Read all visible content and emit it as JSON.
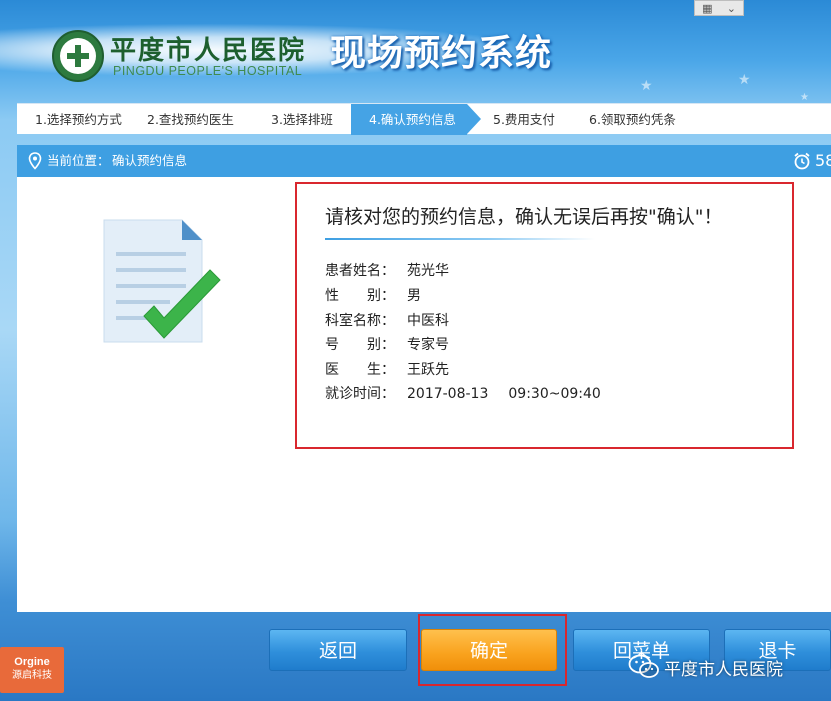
{
  "header": {
    "hospital_name": "平度市人民医院",
    "hospital_name_en": "PINGDU PEOPLE'S HOSPITAL",
    "system_title": "现场预约系统"
  },
  "steps": [
    {
      "label": "1.选择预约方式",
      "active": false
    },
    {
      "label": "2.查找预约医生",
      "active": false
    },
    {
      "label": "3.选择排班",
      "active": false
    },
    {
      "label": "4.确认预约信息",
      "active": true
    },
    {
      "label": "5.费用支付",
      "active": false
    },
    {
      "label": "6.领取预约凭条",
      "active": false
    }
  ],
  "location": {
    "label": "当前位置：",
    "value": "确认预约信息",
    "countdown": "58"
  },
  "confirm": {
    "title": "请核对您的预约信息，确认无误后再按\"确认\"！",
    "rows": [
      {
        "label": "患者姓名：",
        "value": "苑光华"
      },
      {
        "label": "性　　别：",
        "value": "男"
      },
      {
        "label": "科室名称：",
        "value": "中医科"
      },
      {
        "label": "号　　别：",
        "value": "专家号"
      },
      {
        "label": "医　　生：",
        "value": "王跃先"
      },
      {
        "label": "就诊时间：",
        "value": "2017-08-13",
        "extra": "09:30~09:40"
      }
    ]
  },
  "buttons": {
    "back": "返回",
    "ok": "确定",
    "menu": "回菜单",
    "card": "退卡"
  },
  "brand": {
    "line1": "Orgine",
    "line2": "源启科技"
  },
  "watermark": "平度市人民医院",
  "colors": {
    "accent_blue": "#3e9fe2",
    "confirm_orange": "#f9a21d",
    "highlight_red": "#d9272e",
    "logo_green": "#2d7a3f"
  }
}
